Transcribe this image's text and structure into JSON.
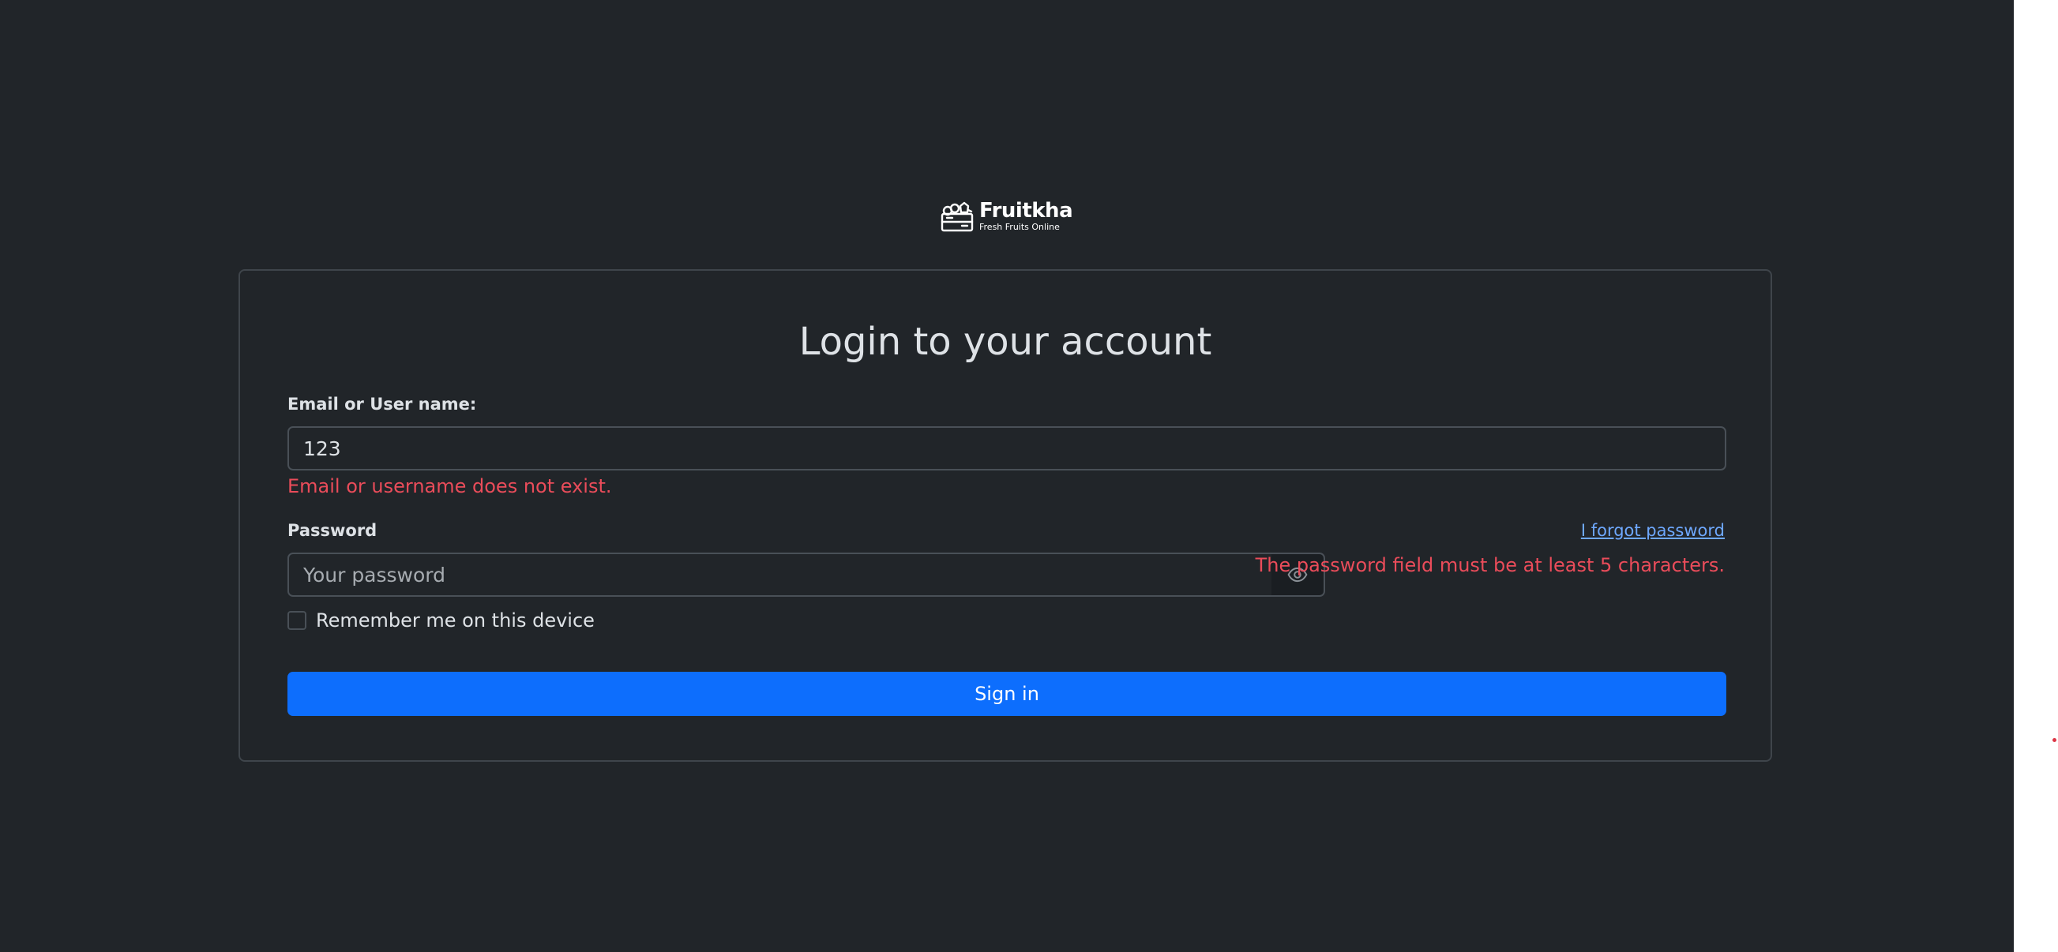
{
  "logo": {
    "icon": "fruit-crate-icon",
    "name": "Fruitkha",
    "tagline": "Fresh Fruits Online"
  },
  "login": {
    "title": "Login to your account",
    "email_label": "Email or User name:",
    "email_value": "123",
    "email_error": "Email or username does not exist.",
    "password_label": "Password",
    "password_placeholder": "Your password",
    "password_error": "The password field must be at least 5 characters.",
    "forgot_label": "I forgot password",
    "remember_label": "Remember me on this device",
    "remember_checked": false,
    "signin_label": "Sign in",
    "toggle_icon": "eye-icon"
  },
  "colors": {
    "background": "#212529",
    "primary": "#0d6efd",
    "error": "#ea4c5a",
    "link": "#6ea8fe",
    "text": "#dee2e6"
  }
}
